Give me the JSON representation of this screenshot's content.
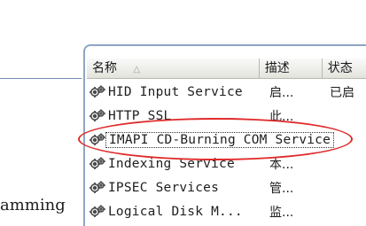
{
  "left_pane": {
    "text": "amming"
  },
  "columns": {
    "name": "名称",
    "sort_indicator": "△",
    "description": "描述",
    "status": "状态"
  },
  "services": [
    {
      "name": "HID Input Service",
      "description": "启...",
      "status": "已启"
    },
    {
      "name": "HTTP SSL",
      "description": "此...",
      "status": ""
    },
    {
      "name": "IMAPI CD-Burning COM Service",
      "description": "",
      "status": ""
    },
    {
      "name": "Indexing Service",
      "description": "本...",
      "status": ""
    },
    {
      "name": "IPSEC Services",
      "description": "管...",
      "status": ""
    },
    {
      "name": "Logical Disk M...",
      "description": "监...",
      "status": ""
    }
  ],
  "colors": {
    "highlight_ellipse": "#e02a2a",
    "pane_border": "#8ea6c4"
  },
  "icons": {
    "service": "gear-icon"
  }
}
